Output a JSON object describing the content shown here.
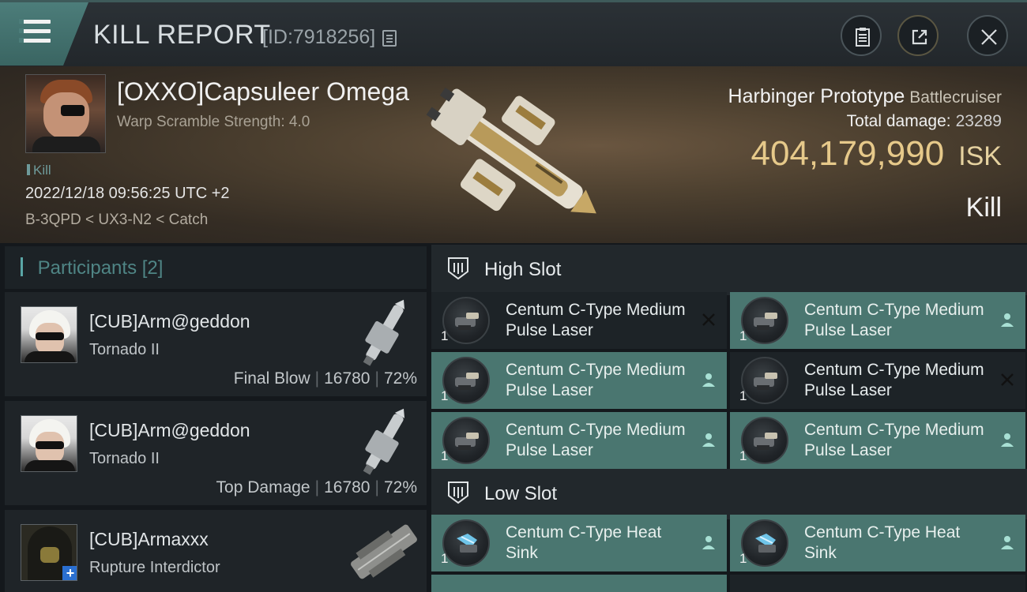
{
  "header": {
    "title": "KILL REPORT",
    "report_id": "[ID:7918256]",
    "icons": [
      "menu-icon",
      "copy-icon",
      "clipboard-icon",
      "share-icon",
      "close-icon"
    ]
  },
  "victim": {
    "name": "[OXXO]Capsuleer Omega",
    "subtitle": "Warp Scramble Strength: 4.0",
    "kill_tag": "Kill",
    "datetime": "2022/12/18 09:56:25 UTC +2",
    "location_path": "B-3QPD < UX3-N2 < Catch",
    "ship_name": "Harbinger Prototype",
    "ship_class": "Battlecruiser",
    "total_damage_label": "Total damage:",
    "total_damage": "23289",
    "isk_value": "404,179,990",
    "isk_unit": "ISK",
    "result": "Kill"
  },
  "participants": {
    "label": "Participants",
    "count": "[2]",
    "rows": [
      {
        "name": "[CUB]Arm@geddon",
        "ship": "Tornado II",
        "role": "Final Blow",
        "damage": "16780",
        "percent": "72%"
      },
      {
        "name": "[CUB]Arm@geddon",
        "ship": "Tornado II",
        "role": "Top Damage",
        "damage": "16780",
        "percent": "72%"
      },
      {
        "name": "[CUB]Armaxxx",
        "ship": "Rupture Interdictor",
        "role": "",
        "damage": "",
        "percent": ""
      }
    ]
  },
  "high_slot": {
    "label": "High Slot",
    "modules": [
      {
        "qty": "1",
        "name": "Centum C-Type Medium Pulse Laser",
        "state": "destroyed"
      },
      {
        "qty": "1",
        "name": "Centum C-Type Medium Pulse Laser",
        "state": "dropped"
      },
      {
        "qty": "1",
        "name": "Centum C-Type Medium Pulse Laser",
        "state": "dropped"
      },
      {
        "qty": "1",
        "name": "Centum C-Type Medium Pulse Laser",
        "state": "destroyed"
      },
      {
        "qty": "1",
        "name": "Centum C-Type Medium Pulse Laser",
        "state": "dropped"
      },
      {
        "qty": "1",
        "name": "Centum C-Type Medium Pulse Laser",
        "state": "dropped"
      }
    ]
  },
  "low_slot": {
    "label": "Low Slot",
    "modules": [
      {
        "qty": "1",
        "name": "Centum C-Type Heat Sink",
        "state": "dropped"
      },
      {
        "qty": "1",
        "name": "Centum C-Type Heat Sink",
        "state": "dropped"
      }
    ]
  },
  "colors": {
    "accent_teal": "#4a7670",
    "isk_gold": "#e6c98a",
    "header_teal": "#4c7d7a",
    "participants_label": "#4f8585"
  }
}
